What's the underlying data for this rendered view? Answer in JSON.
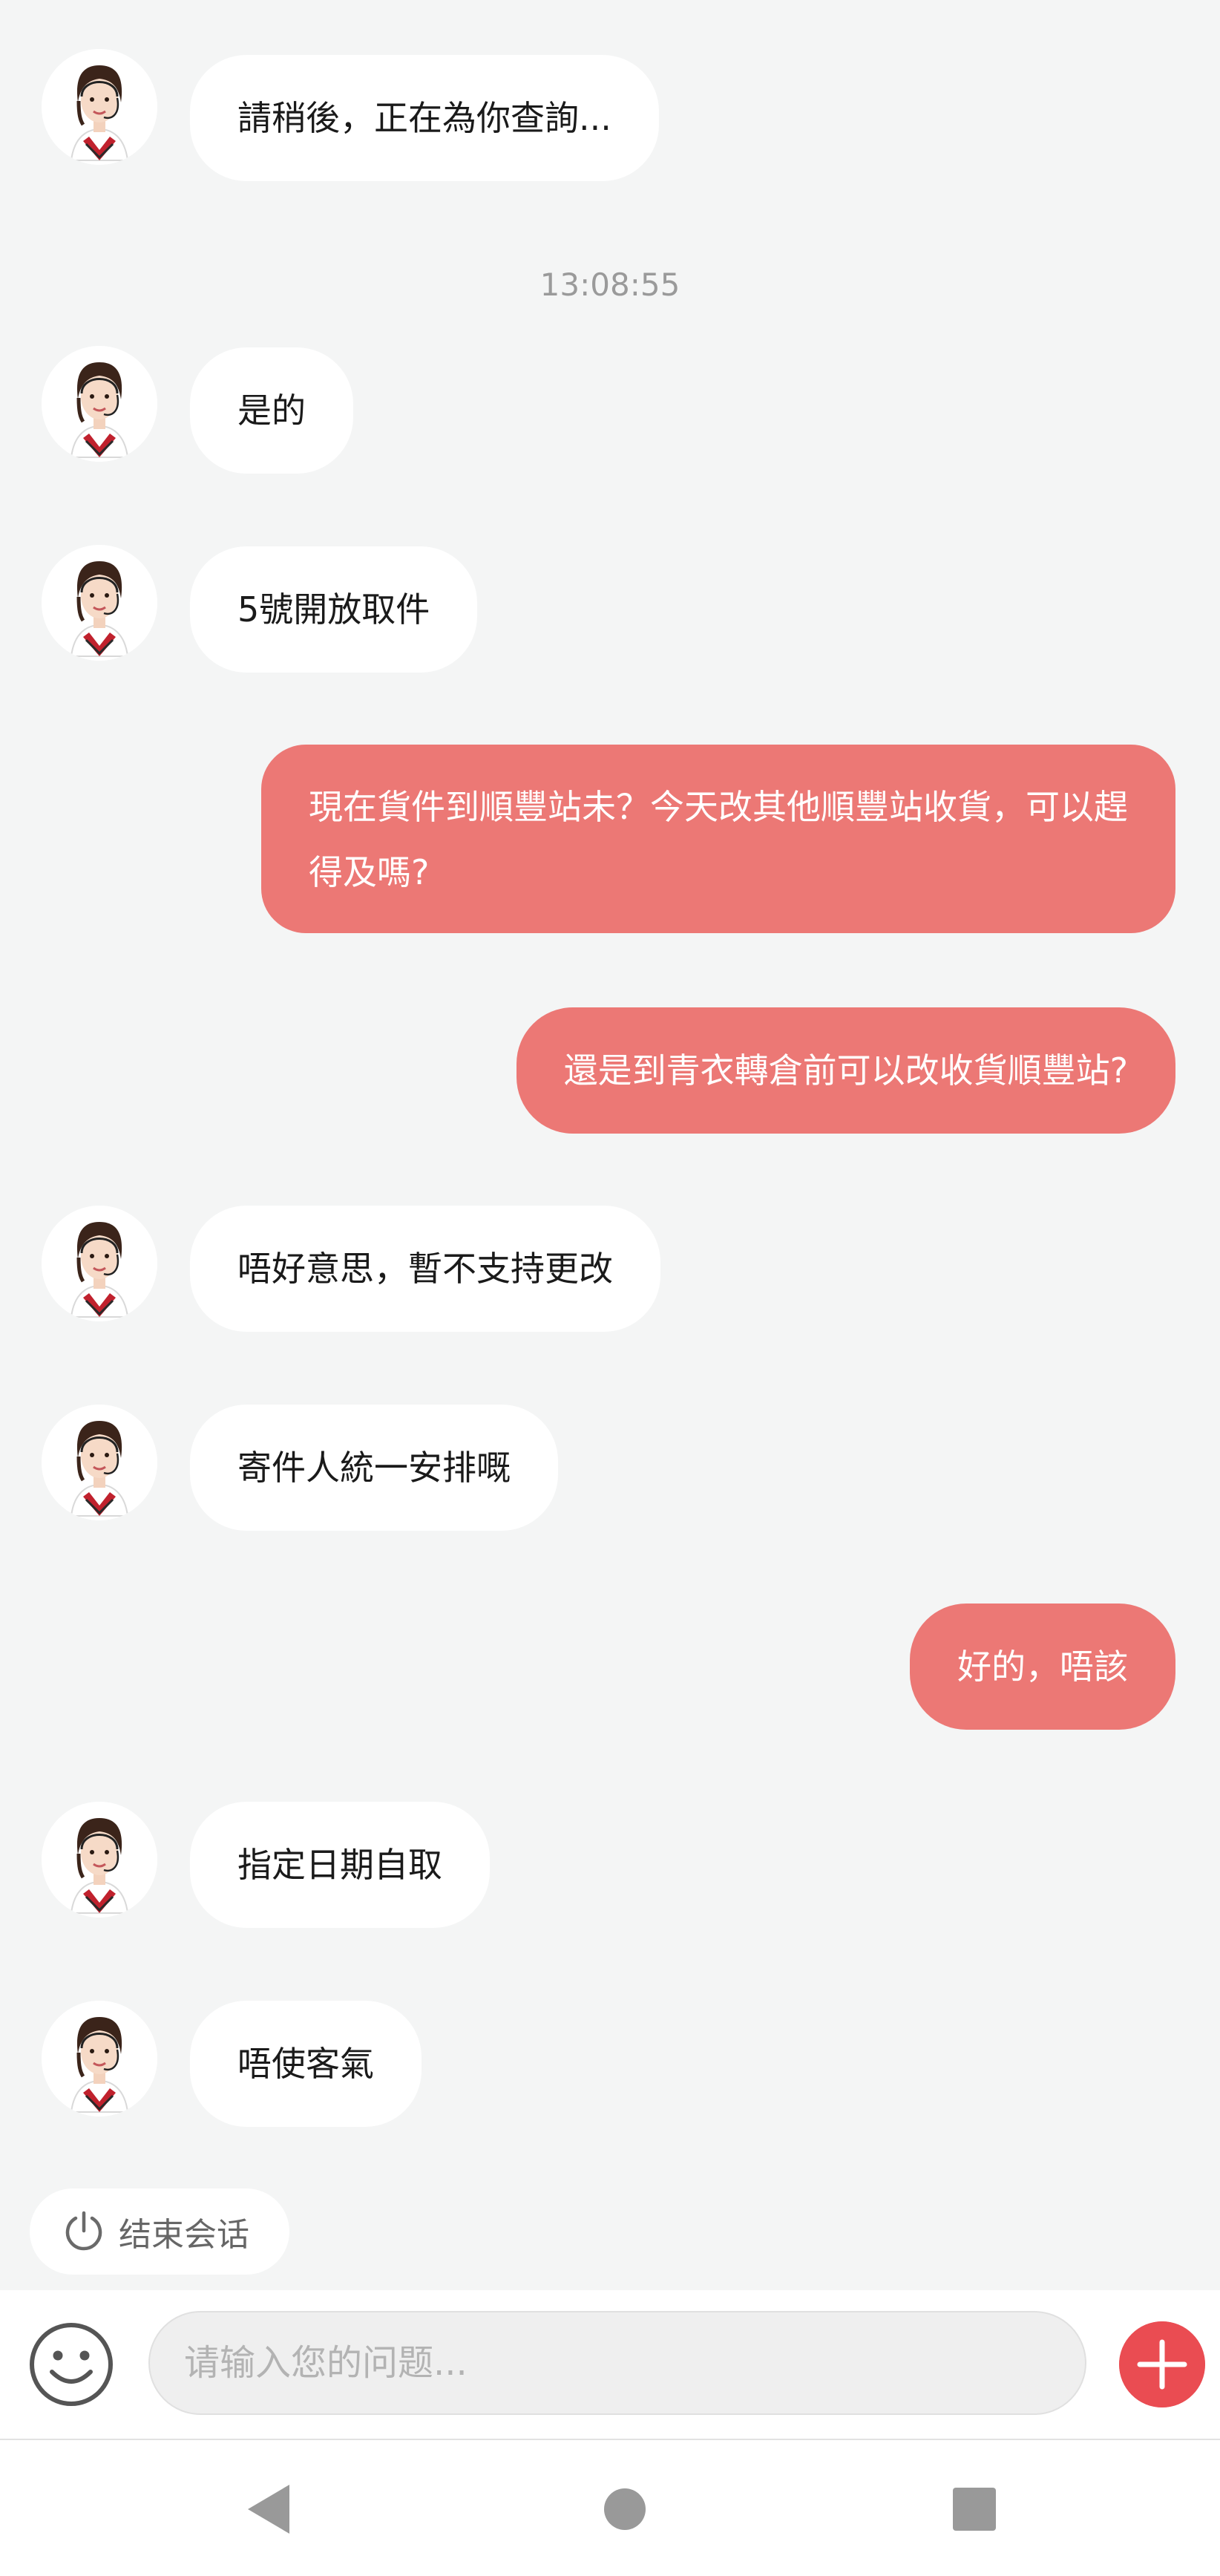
{
  "timestamp": "13:08:55",
  "messages": [
    {
      "side": "in",
      "text": "請稍後，正在為你查詢..."
    },
    {
      "side": "in",
      "text": "是的"
    },
    {
      "side": "in",
      "text": "5號開放取件"
    },
    {
      "side": "out",
      "text": "現在貨件到順豐站未？今天改其他順豐站收貨，可以趕得及嗎?"
    },
    {
      "side": "out",
      "text": "還是到青衣轉倉前可以改收貨順豐站?"
    },
    {
      "side": "in",
      "text": "唔好意思，暫不支持更改"
    },
    {
      "side": "in",
      "text": "寄件人統一安排嘅"
    },
    {
      "side": "out",
      "text": "好的，唔該"
    },
    {
      "side": "in",
      "text": "指定日期自取"
    },
    {
      "side": "in",
      "text": "唔使客氣"
    }
  ],
  "end_session": {
    "label": "结束会话",
    "icon": "power-icon"
  },
  "input": {
    "placeholder": "请输入您的问题...",
    "value": ""
  },
  "icons": {
    "emoji": "smiley-icon",
    "add": "plus-icon"
  },
  "colors": {
    "outgoing_bubble": "#ec7875",
    "incoming_bubble": "#ffffff",
    "add_button": "#ea4c52",
    "background": "#f4f5f5"
  }
}
